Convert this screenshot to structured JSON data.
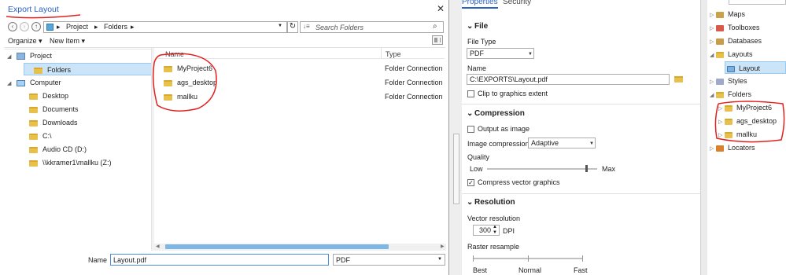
{
  "dialog": {
    "title": "Export Layout",
    "close_glyph": "✕",
    "breadcrumb": [
      "Project",
      "Folders"
    ],
    "search_placeholder": "Search Folders",
    "organize_label": "Organize ▾",
    "new_item_label": "New Item ▾",
    "nav_tree": [
      {
        "label": "Project",
        "icon": "project-icon"
      },
      {
        "label": "Folders",
        "icon": "folder-icon",
        "selected": true
      },
      {
        "label": "Computer",
        "icon": "computer-icon"
      },
      {
        "label": "Desktop",
        "icon": "folder-icon"
      },
      {
        "label": "Documents",
        "icon": "folder-icon"
      },
      {
        "label": "Downloads",
        "icon": "folder-icon"
      },
      {
        "label": "C:\\",
        "icon": "folder-icon"
      },
      {
        "label": "Audio CD (D:)",
        "icon": "folder-icon"
      },
      {
        "label": "\\\\kkramer1\\mallku (Z:)",
        "icon": "folder-icon"
      }
    ],
    "columns": {
      "name": "Name",
      "type": "Type"
    },
    "files": [
      {
        "name": "MyProject6",
        "type": "Folder Connection"
      },
      {
        "name": "ags_desktop",
        "type": "Folder Connection"
      },
      {
        "name": "mallku",
        "type": "Folder Connection"
      }
    ],
    "name_label": "Name",
    "name_value": "Layout.pdf",
    "type_value": "PDF"
  },
  "properties": {
    "tabs": [
      "Properties",
      "Security"
    ],
    "file_section": "File",
    "file_type_label": "File Type",
    "file_type_value": "PDF",
    "name_label": "Name",
    "name_value": "C:\\EXPORTS\\Layout.pdf",
    "clip_label": "Clip to graphics extent",
    "clip_checked": false,
    "compression_section": "Compression",
    "output_image_label": "Output as image",
    "output_image_checked": false,
    "image_compression_label": "Image compression",
    "image_compression_value": "Adaptive",
    "quality_label": "Quality",
    "quality_low": "Low",
    "quality_high": "Max",
    "quality_level": 0.9,
    "compress_vector_label": "Compress vector graphics",
    "compress_vector_checked": true,
    "resolution_section": "Resolution",
    "vector_res_label": "Vector resolution",
    "vector_res_value": "300",
    "vector_res_unit": "DPI",
    "raster_resample_label": "Raster resample",
    "raster_ticks": [
      "Best",
      "Normal",
      "Fast"
    ]
  },
  "catalog": {
    "items": [
      {
        "label": "Maps",
        "level": 0
      },
      {
        "label": "Toolboxes",
        "level": 0
      },
      {
        "label": "Databases",
        "level": 0
      },
      {
        "label": "Layouts",
        "level": 0,
        "expanded": true
      },
      {
        "label": "Layout",
        "level": 1,
        "selected": true
      },
      {
        "label": "Styles",
        "level": 0
      },
      {
        "label": "Folders",
        "level": 0,
        "expanded": true
      },
      {
        "label": "MyProject6",
        "level": 1
      },
      {
        "label": "ags_desktop",
        "level": 1
      },
      {
        "label": "mallku",
        "level": 1
      },
      {
        "label": "Locators",
        "level": 0
      }
    ]
  },
  "colors": {
    "accent": "#2962c4",
    "selection": "#cce4f7",
    "annotation_red": "#e32020",
    "folder": "#e8c14d"
  }
}
